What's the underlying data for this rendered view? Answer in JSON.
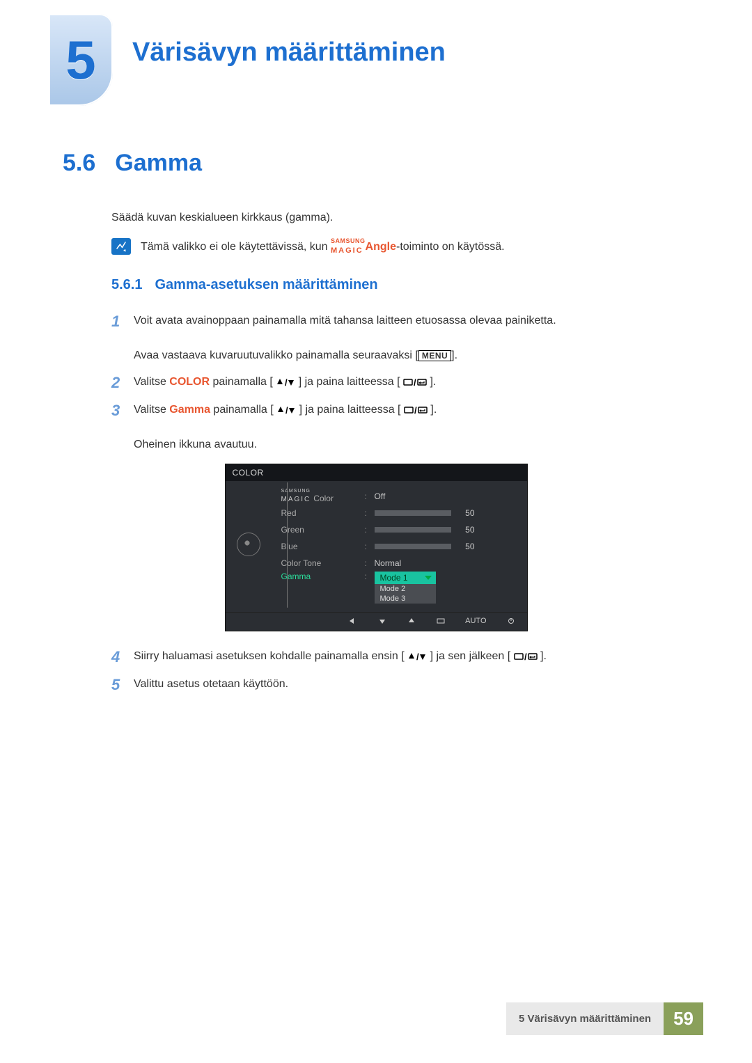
{
  "chapter": {
    "number": "5",
    "title": "Värisävyn määrittäminen"
  },
  "section": {
    "number": "5.6",
    "title": "Gamma"
  },
  "intro": "Säädä kuvan keskialueen kirkkaus (gamma).",
  "note": {
    "prefix": "Tämä valikko ei ole käytettävissä, kun ",
    "brand_sup": "SAMSUNG",
    "brand_low": "MAGIC",
    "brand_word": "Angle",
    "suffix": "-toiminto on käytössä."
  },
  "subsection": {
    "number": "5.6.1",
    "title": "Gamma-asetuksen määrittäminen"
  },
  "steps": {
    "n1": "1",
    "s1a": "Voit avata avainoppaan painamalla mitä tahansa laitteen etuosassa olevaa painiketta.",
    "s1b_pre": "Avaa vastaava kuvaruutuvalikko painamalla seuraavaksi [",
    "s1b_menu": "MENU",
    "s1b_post": "].",
    "n2": "2",
    "s2_pre": "Valitse ",
    "s2_color": "COLOR",
    "s2_mid": " painamalla [",
    "s2_mid2": "] ja paina laitteessa [",
    "s2_end": "].",
    "n3": "3",
    "s3_pre": "Valitse ",
    "s3_gamma": "Gamma",
    "s3_mid": " painamalla [",
    "s3_mid2": "] ja paina laitteessa [",
    "s3_end": "].",
    "s3_after": "Oheinen ikkuna avautuu.",
    "n4": "4",
    "s4_pre": "Siirry haluamasi asetuksen kohdalle painamalla ensin [",
    "s4_mid": "] ja sen jälkeen [",
    "s4_end": "].",
    "n5": "5",
    "s5": "Valittu asetus otetaan käyttöön."
  },
  "osd": {
    "title": "COLOR",
    "magic_sup": "SAMSUNG",
    "magic_low": "MAGIC",
    "magic_color_label": "Color",
    "rows": {
      "magic_color_value": "Off",
      "red": "Red",
      "green": "Green",
      "blue": "Blue",
      "val50": "50",
      "color_tone": "Color Tone",
      "color_tone_value": "Normal",
      "gamma": "Gamma",
      "mode1": "Mode 1",
      "mode2": "Mode 2",
      "mode3": "Mode 3"
    },
    "footer": {
      "auto": "AUTO"
    }
  },
  "footer": {
    "label": "5 Värisävyn määrittäminen",
    "page": "59"
  }
}
